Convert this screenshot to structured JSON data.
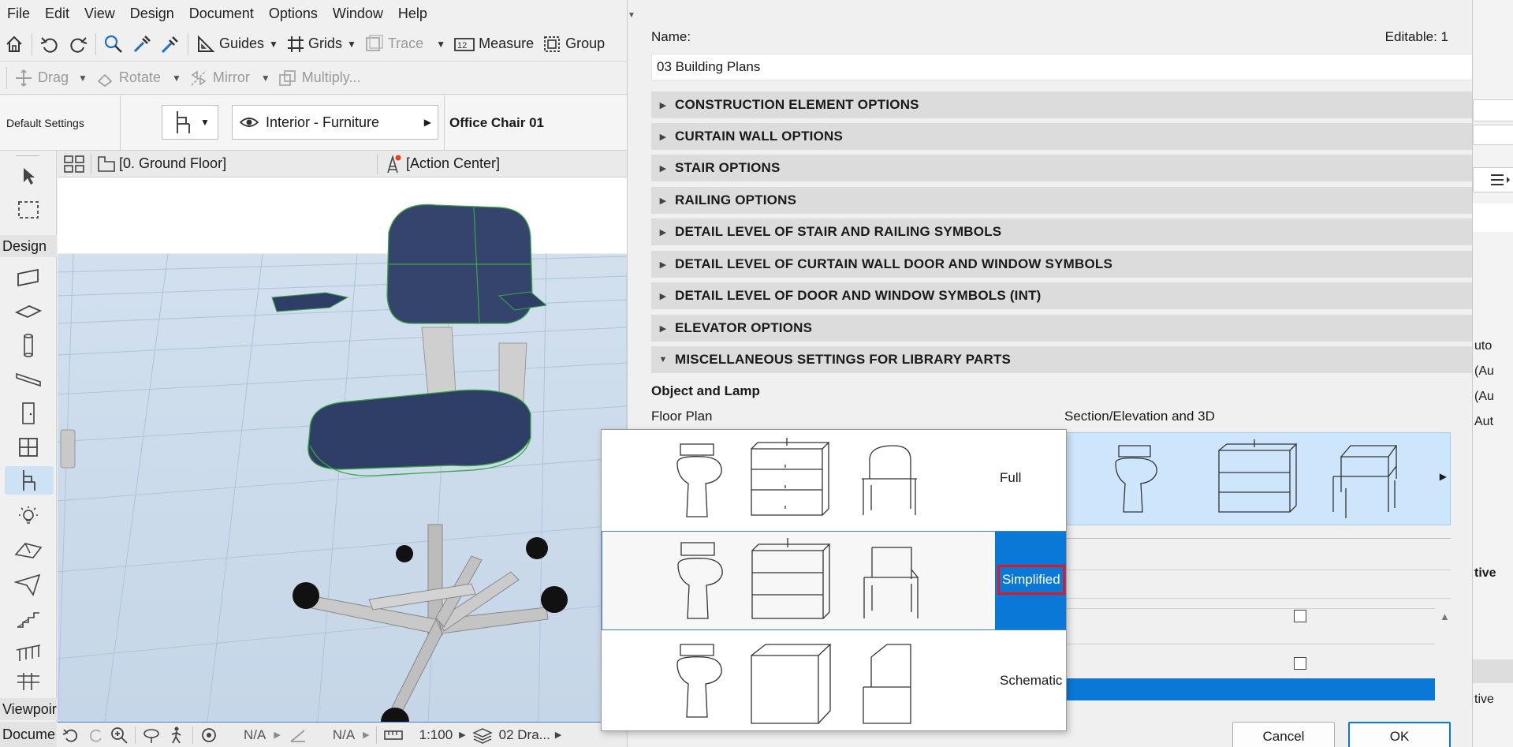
{
  "menubar": {
    "items": [
      "File",
      "Edit",
      "View",
      "Design",
      "Document",
      "Options",
      "Window",
      "Help"
    ]
  },
  "toolbar1": {
    "guides": "Guides",
    "grids": "Grids",
    "trace": "Trace",
    "measure": "Measure",
    "group": "Group"
  },
  "toolbar2": {
    "drag": "Drag",
    "rotate": "Rotate",
    "mirror": "Mirror",
    "multiply": "Multiply..."
  },
  "infobox": {
    "default_settings": "Default Settings",
    "layer": "Interior - Furniture",
    "object_name": "Office Chair 01"
  },
  "toolbox": {
    "design_label": "Design",
    "viewpoint_label": "Viewpoir",
    "document_label": "Docume"
  },
  "viewport": {
    "floor": "[0. Ground Floor]",
    "action_center": "[Action Center]"
  },
  "statusbar": {
    "na1": "N/A",
    "na2": "N/A",
    "scale": "1:100",
    "layer_combo": "02 Dra..."
  },
  "dialog": {
    "name_label": "Name:",
    "editable": "Editable: 1",
    "name_value": "03 Building Plans",
    "sections": [
      "CONSTRUCTION ELEMENT OPTIONS",
      "CURTAIN WALL OPTIONS",
      "STAIR OPTIONS",
      "RAILING OPTIONS",
      "DETAIL LEVEL OF STAIR AND RAILING SYMBOLS",
      "DETAIL LEVEL OF CURTAIN WALL DOOR AND WINDOW SYMBOLS",
      "DETAIL LEVEL OF DOOR AND WINDOW SYMBOLS (INT)",
      "ELEVATOR OPTIONS",
      "MISCELLANEOUS SETTINGS FOR LIBRARY PARTS"
    ],
    "object_lamp": "Object and Lamp",
    "floor_plan": "Floor Plan",
    "section_elev": "Section/Elevation and 3D",
    "cancel": "Cancel",
    "ok": "OK"
  },
  "popup": {
    "options": [
      "Full",
      "Simplified",
      "Schematic"
    ],
    "selected": "Simplified"
  },
  "rightstrip": {
    "t1": "uto",
    "t2": "(Au",
    "t3": "(Au",
    "t4": "Aut",
    "t5": "tive",
    "t6": "tive"
  },
  "colors": {
    "selection": "#0a78d7",
    "highlight_border": "#e8141c",
    "preview_bg": "#cde6fb"
  }
}
